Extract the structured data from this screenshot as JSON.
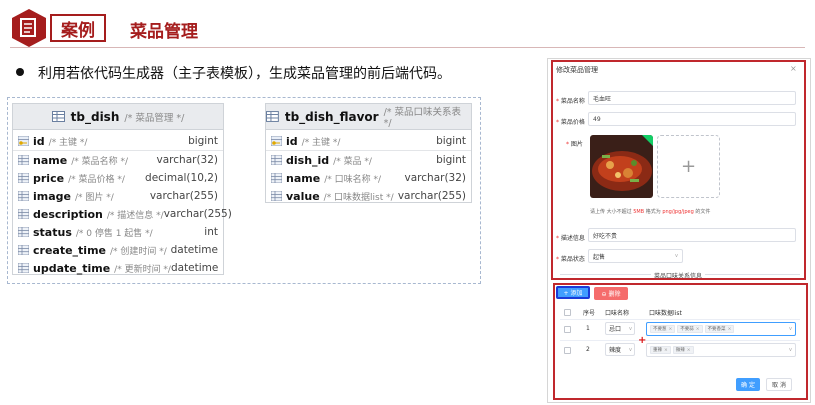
{
  "header": {
    "tag": "案例",
    "title": "菜品管理"
  },
  "bullet_text": "利用若依代码生成器（主子表模板），生成菜品管理的前后端代码。",
  "tables": [
    {
      "name": "tb_dish",
      "comment": "/* 菜品管理 */",
      "fields": [
        {
          "name": "id",
          "comment": "/* 主键 */",
          "type": "bigint",
          "key": true
        },
        {
          "name": "name",
          "comment": "/* 菜品名称 */",
          "type": "varchar(32)",
          "key": false
        },
        {
          "name": "price",
          "comment": "/* 菜品价格 */",
          "type": "decimal(10,2)",
          "key": false
        },
        {
          "name": "image",
          "comment": "/* 图片 */",
          "type": "varchar(255)",
          "key": false
        },
        {
          "name": "description",
          "comment": "/* 描述信息 */",
          "type": "varchar(255)",
          "key": false
        },
        {
          "name": "status",
          "comment": "/* 0 停售 1 起售 */",
          "type": "int",
          "key": false
        },
        {
          "name": "create_time",
          "comment": "/* 创建时间 */",
          "type": "datetime",
          "key": false
        },
        {
          "name": "update_time",
          "comment": "/* 更新时间 */",
          "type": "datetime",
          "key": false
        }
      ]
    },
    {
      "name": "tb_dish_flavor",
      "comment": "/* 菜品口味关系表 */",
      "fields": [
        {
          "name": "id",
          "comment": "/* 主键 */",
          "type": "bigint",
          "key": true
        },
        {
          "name": "dish_id",
          "comment": "/* 菜品 */",
          "type": "bigint",
          "key": false
        },
        {
          "name": "name",
          "comment": "/* 口味名称 */",
          "type": "varchar(32)",
          "key": false
        },
        {
          "name": "value",
          "comment": "/* 口味数据list */",
          "type": "varchar(255)",
          "key": false
        }
      ]
    }
  ],
  "dialog": {
    "title": "修改菜品管理",
    "close": "×",
    "fields": {
      "name_label": "菜品名称",
      "name_value": "毛血旺",
      "price_label": "菜品价格",
      "price_value": "49",
      "image_label": "图片",
      "upload_plus": "+",
      "tip_prefix": "请上传 大小不超过",
      "tip_size": "5MB",
      "tip_mid": "格式为",
      "tip_formats": "png/jpg/jpeg",
      "tip_suffix": "的文件",
      "desc_label": "描述信息",
      "desc_value": "好吃不贵",
      "status_label": "菜品状态",
      "status_value": "起售"
    },
    "divider": "菜品口味关系信息",
    "sub": {
      "add": "+ 添加",
      "delete": "⊖ 删除",
      "col_index": "序号",
      "col_name": "口味名称",
      "col_list": "口味数据list",
      "rows": [
        {
          "index": "1",
          "name": "忌口",
          "tags": [
            "不要葱",
            "不要蒜",
            "不要香菜"
          ]
        },
        {
          "index": "2",
          "name": "辣度",
          "tags": [
            "重辣",
            "微辣"
          ]
        }
      ]
    },
    "ok": "确 定",
    "cancel": "取 消"
  },
  "colors": {
    "accent": "#a51d1d",
    "primary": "#409eff",
    "danger": "#f56c6c",
    "highlight": "#c0282d"
  }
}
